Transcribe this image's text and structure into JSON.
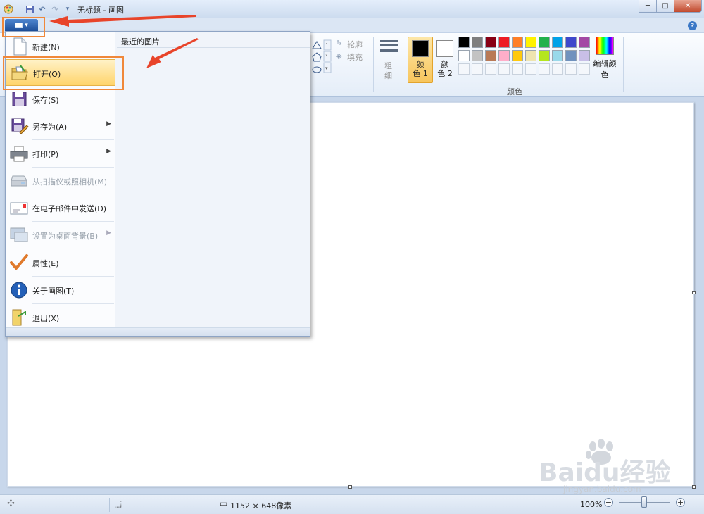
{
  "window": {
    "title": "无标题 - 画图",
    "minimize": "─",
    "maximize": "□",
    "close": "✕"
  },
  "help_icon": "?",
  "ribbon": {
    "outline_label": "轮廓",
    "fill_label": "填充",
    "size_label_1": "粗",
    "size_label_2": "细",
    "color1_label_1": "颜",
    "color1_label_2": "色 1",
    "color2_label_1": "颜",
    "color2_label_2": "色 2",
    "edit_colors_label": "编辑颜色",
    "colors_group_label": "颜色",
    "palette_row1": [
      "#000000",
      "#7f7f7f",
      "#880015",
      "#ed1c24",
      "#ff7f27",
      "#fff200",
      "#22b14c",
      "#00a2e8",
      "#3f48cc",
      "#a349a4"
    ],
    "palette_row2": [
      "#ffffff",
      "#c3c3c3",
      "#b97a57",
      "#ffaec9",
      "#ffc90e",
      "#efe4b0",
      "#b5e61d",
      "#99d9ea",
      "#7092be",
      "#c8bfe7"
    ],
    "color1": "#000000",
    "color2": "#ffffff"
  },
  "app_menu": {
    "recent_title": "最近的图片",
    "items": [
      {
        "label": "新建(N)",
        "icon": "new-document-icon"
      },
      {
        "label": "打开(O)",
        "icon": "open-folder-icon"
      },
      {
        "label": "保存(S)",
        "icon": "save-disk-icon"
      },
      {
        "label": "另存为(A)",
        "icon": "save-as-icon"
      },
      {
        "label": "打印(P)",
        "icon": "printer-icon"
      },
      {
        "label": "从扫描仪或照相机(M)",
        "icon": "scanner-icon"
      },
      {
        "label": "在电子邮件中发送(D)",
        "icon": "email-icon"
      },
      {
        "label": "设置为桌面背景(B)",
        "icon": "desktop-background-icon"
      },
      {
        "label": "属性(E)",
        "icon": "checkmark-icon"
      },
      {
        "label": "关于画图(T)",
        "icon": "info-icon"
      },
      {
        "label": "退出(X)",
        "icon": "exit-icon"
      }
    ]
  },
  "status": {
    "image_size": "1152 × 648像素",
    "zoom": "100%",
    "zoom_out": "−",
    "zoom_in": "+"
  },
  "watermark": {
    "logo": "Baidu经验",
    "url": "jingyan.baidu.com"
  }
}
